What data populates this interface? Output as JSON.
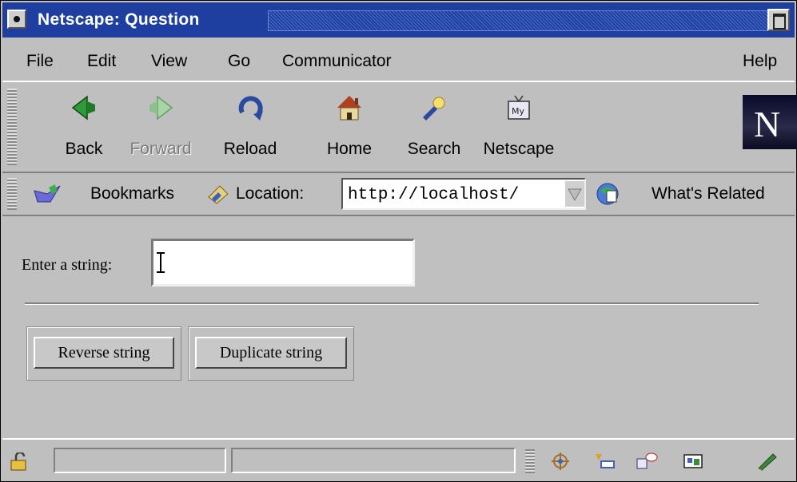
{
  "window": {
    "title": "Netscape: Question"
  },
  "menu": [
    "File",
    "Edit",
    "View",
    "Go",
    "Communicator",
    "Help"
  ],
  "navigation": {
    "back": "Back",
    "forward": "Forward",
    "reload": "Reload",
    "home": "Home",
    "search": "Search",
    "netscape": "Netscape"
  },
  "location_bar": {
    "bookmarks": "Bookmarks",
    "location_label": "Location:",
    "url": "http://localhost/",
    "whats_related": "What's Related"
  },
  "page": {
    "input_label": "Enter a string:",
    "input_value": "",
    "buttons": {
      "reverse": "Reverse string",
      "duplicate": "Duplicate string"
    }
  },
  "colors": {
    "titlebar": "#1f3fa0",
    "chrome": "#bfbfbf"
  }
}
